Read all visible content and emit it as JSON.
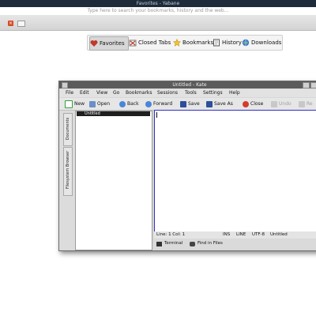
{
  "firefox": {
    "title": "Favorites - Yabane",
    "search_hint": "Type here to search your bookmarks, history and the web...",
    "tab_close_glyph": "×"
  },
  "library": {
    "tabs": [
      {
        "label": "Favorites",
        "icon": "heart-icon"
      },
      {
        "label": "Closed Tabs",
        "icon": "closed-tabs-icon"
      },
      {
        "label": "Bookmarks",
        "icon": "star-icon"
      },
      {
        "label": "History",
        "icon": "history-icon"
      },
      {
        "label": "Downloads",
        "icon": "downloads-icon"
      }
    ],
    "selected": "Favorites"
  },
  "kate": {
    "title": "Untitled - Kate",
    "menu": [
      "File",
      "Edit",
      "View",
      "Go",
      "Bookmarks",
      "Sessions",
      "Tools",
      "Settings",
      "Help"
    ],
    "toolbar": {
      "new": "New",
      "open": "Open",
      "back": "Back",
      "forward": "Forward",
      "save": "Save",
      "save_as": "Save As",
      "close": "Close",
      "undo": "Undo",
      "redo": "Re"
    },
    "sidebar": {
      "documents": "Documents",
      "filesystem": "Filesystem Browser"
    },
    "documents": [
      "Untitled"
    ],
    "status": {
      "position": "Line: 1 Col: 1",
      "mode": "INS",
      "linemode": "LINE",
      "encoding": "UTF-8",
      "filename": "Untitled"
    },
    "bottom_tabs": [
      "Terminal",
      "Find in Files"
    ]
  },
  "colors": {
    "kate_titlebar": "#5b5b5b",
    "editor_border": "#3030c8",
    "close_red": "#d64a28"
  }
}
